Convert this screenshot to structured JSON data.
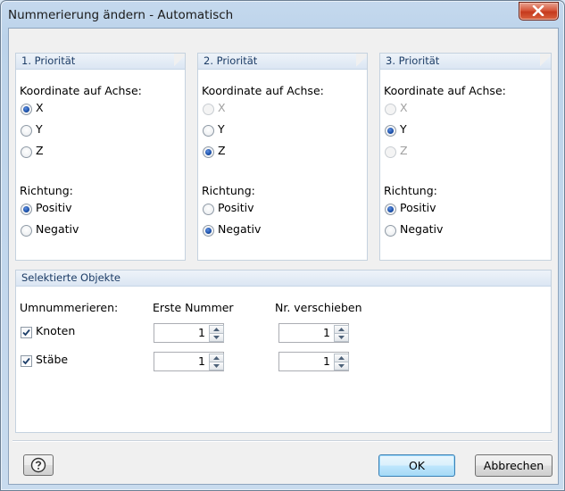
{
  "window": {
    "title": "Nummerierung ändern - Automatisch"
  },
  "priorities": [
    {
      "header": "1. Priorität",
      "axis_label": "Koordinate auf Achse:",
      "axes": [
        {
          "label": "X",
          "checked": true,
          "enabled": true
        },
        {
          "label": "Y",
          "checked": false,
          "enabled": true
        },
        {
          "label": "Z",
          "checked": false,
          "enabled": true
        }
      ],
      "direction_label": "Richtung:",
      "directions": [
        {
          "label": "Positiv",
          "checked": true
        },
        {
          "label": "Negativ",
          "checked": false
        }
      ]
    },
    {
      "header": "2. Priorität",
      "axis_label": "Koordinate auf Achse:",
      "axes": [
        {
          "label": "X",
          "checked": false,
          "enabled": false
        },
        {
          "label": "Y",
          "checked": false,
          "enabled": true
        },
        {
          "label": "Z",
          "checked": true,
          "enabled": true
        }
      ],
      "direction_label": "Richtung:",
      "directions": [
        {
          "label": "Positiv",
          "checked": false
        },
        {
          "label": "Negativ",
          "checked": true
        }
      ]
    },
    {
      "header": "3. Priorität",
      "axis_label": "Koordinate auf Achse:",
      "axes": [
        {
          "label": "X",
          "checked": false,
          "enabled": false
        },
        {
          "label": "Y",
          "checked": true,
          "enabled": true
        },
        {
          "label": "Z",
          "checked": false,
          "enabled": false
        }
      ],
      "direction_label": "Richtung:",
      "directions": [
        {
          "label": "Positiv",
          "checked": true
        },
        {
          "label": "Negativ",
          "checked": false
        }
      ]
    }
  ],
  "selected": {
    "header": "Selektierte Objekte",
    "renumber_label": "Umnummerieren:",
    "first_number_label": "Erste Nummer",
    "shift_label": "Nr. verschieben",
    "rows": [
      {
        "label": "Knoten",
        "checked": true,
        "first": "1",
        "shift": "1"
      },
      {
        "label": "Stäbe",
        "checked": true,
        "first": "1",
        "shift": "1"
      }
    ]
  },
  "buttons": {
    "ok": "OK",
    "cancel": "Abbrechen"
  },
  "icons": {
    "help": "help-icon",
    "close": "close-icon"
  }
}
